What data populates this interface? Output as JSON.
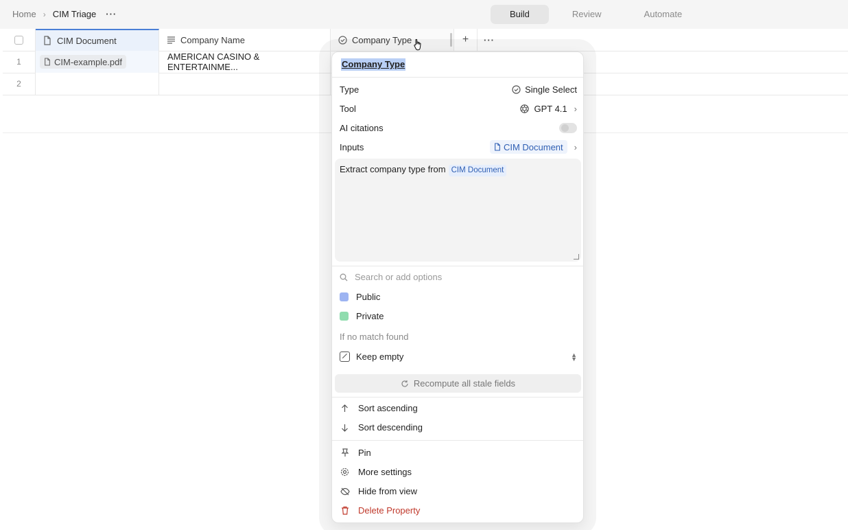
{
  "breadcrumb": {
    "home": "Home",
    "current": "CIM Triage",
    "more": "···"
  },
  "modes": [
    {
      "label": "Build",
      "active": true
    },
    {
      "label": "Review",
      "active": false
    },
    {
      "label": "Automate",
      "active": false
    }
  ],
  "table": {
    "columns": {
      "doc": "CIM Document",
      "name": "Company Name",
      "type": "Company Type",
      "add": "+",
      "more": "···"
    },
    "rows": [
      {
        "num": "1",
        "doc": "CIM-example.pdf",
        "name": "AMERICAN CASINO & ENTERTAINME..."
      },
      {
        "num": "2",
        "doc": "",
        "name": ""
      }
    ]
  },
  "popover": {
    "title": "Company Type",
    "type_label": "Type",
    "type_value": "Single Select",
    "tool_label": "Tool",
    "tool_value": "GPT 4.1",
    "citations_label": "AI citations",
    "citations_enabled": false,
    "inputs_label": "Inputs",
    "inputs_value": "CIM Document",
    "prompt_text": "Extract company type from",
    "prompt_ref": "CIM Document",
    "search_placeholder": "Search or add options",
    "options": [
      {
        "label": "Public",
        "color": "#9db4f2"
      },
      {
        "label": "Private",
        "color": "#8fdcae"
      }
    ],
    "no_match_label": "If no match found",
    "no_match_value": "Keep empty",
    "recompute_label": "Recompute all stale fields",
    "sort_asc": "Sort ascending",
    "sort_desc": "Sort descending",
    "pin": "Pin",
    "more_settings": "More settings",
    "hide": "Hide from view",
    "delete": "Delete Property"
  },
  "colors": {
    "accent": "#4a7fd6",
    "danger": "#c0392b",
    "selection": "#b9cff5"
  }
}
